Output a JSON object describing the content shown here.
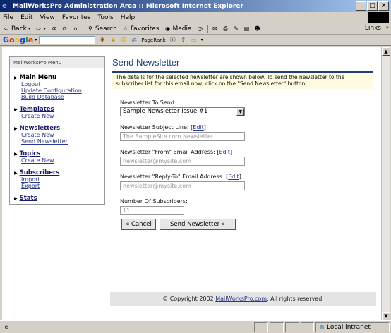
{
  "window": {
    "title": "MailWorksPro Administration Area :: Microsoft Internet Explorer"
  },
  "menu": [
    "File",
    "Edit",
    "View",
    "Favorites",
    "Tools",
    "Help"
  ],
  "toolbar": {
    "back": "Back",
    "search": "Search",
    "favorites": "Favorites",
    "media": "Media",
    "links": "Links"
  },
  "google": {
    "logo": [
      "G",
      "o",
      "o",
      "g",
      "l",
      "e"
    ],
    "pagerank": "PageRank"
  },
  "sidebar": {
    "title": "MailWorksPro Menu",
    "groups": [
      {
        "heading": "Main Menu",
        "items": [
          "Logout",
          "Update Configuration",
          "Build Database"
        ]
      },
      {
        "heading": "Templates",
        "items": [
          "Create New"
        ]
      },
      {
        "heading": "Newsletters",
        "items": [
          "Create New",
          "Send Newsletter"
        ]
      },
      {
        "heading": "Topics",
        "items": [
          "Create New"
        ]
      },
      {
        "heading": "Subscribers",
        "items": [
          "Import",
          "Export"
        ]
      },
      {
        "heading": "Stats",
        "items": []
      }
    ]
  },
  "main": {
    "title": "Send Newsletter",
    "info": "The details for the selected newsletter are shown below. To send the newsletter to the subscriber list for this email now, click on the \"Send Newsletter\" button.",
    "fields": {
      "newsletter_label": "Newsletter To Send:",
      "newsletter_value": "Sample Newsletter Issue #1",
      "subject_label": "Newsletter Subject Line: [",
      "subject_value": "The SampleSite.com Newsletter",
      "from_label": "Newsletter \"From\" Email Address: [",
      "from_value": "newsletter@mysite.com",
      "replyto_label": "Newsletter \"Reply-To\" Email Address: [",
      "replyto_value": "newsletter@mysite.com",
      "subscribers_label": "Number Of Subscribers:",
      "subscribers_value": "11",
      "edit": "Edit",
      "bracket_close": "]"
    },
    "cancel_button": "« Cancel",
    "send_button": "Send Newsletter »"
  },
  "footer": {
    "prefix": "© Copyright 2002 ",
    "link": "MailWorksPro.com",
    "suffix": ". All rights reserved."
  },
  "status": {
    "zone": "Local intranet"
  }
}
